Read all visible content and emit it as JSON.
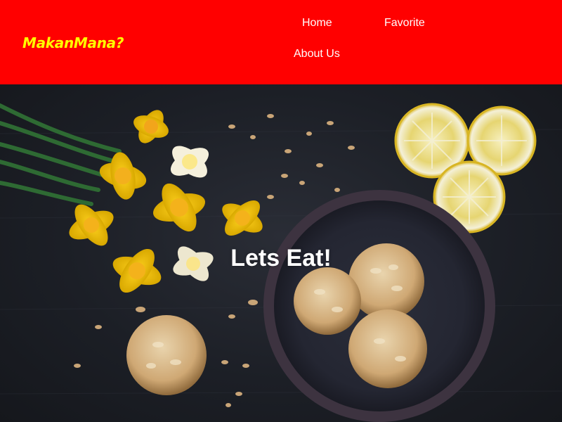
{
  "header": {
    "brand": "MakanMana?",
    "nav": {
      "home": "Home",
      "favorite": "Favorite",
      "about": "About Us"
    }
  },
  "hero": {
    "title": "Lets Eat!",
    "image": "food-photo-cookies-daffodils-lemons"
  },
  "colors": {
    "header_bg": "#ff0000",
    "brand": "#ffff00",
    "nav_text": "#ffffff"
  }
}
